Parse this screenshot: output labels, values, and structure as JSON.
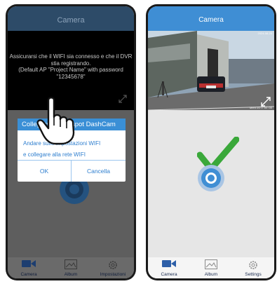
{
  "left_phone": {
    "header": {
      "title": "Camera"
    },
    "video_message": {
      "lines": [
        "Assicurarsi che il WIFI sia connesso e che il DVR",
        "stia registrando.",
        "(Default AP \"Project Name\" with password",
        "\"12345678\""
      ]
    },
    "dialog": {
      "title": "Collegarsi all'Hotspot DashCam",
      "message_lines": [
        "Andare sulle impostazioni WIFI",
        "e collegare alla rete WIFI"
      ],
      "ok_label": "OK",
      "cancel_label": "Cancella"
    },
    "tabs": [
      {
        "label": "Camera",
        "icon": "video-camera-icon"
      },
      {
        "label": "Album",
        "icon": "image-icon"
      },
      {
        "label": "Impostazioni",
        "icon": "gear-icon"
      }
    ]
  },
  "right_phone": {
    "header": {
      "title": "Camera"
    },
    "video": {
      "osd_bottom": "Mem:1G  0 :00 :00",
      "osd_top": "2024-08-20"
    },
    "tabs": [
      {
        "label": "Camera",
        "icon": "video-camera-icon"
      },
      {
        "label": "Album",
        "icon": "image-icon"
      },
      {
        "label": "Settings",
        "icon": "gear-icon"
      }
    ]
  },
  "colors": {
    "header_blue": "#3f8ed4",
    "dialog_blue": "#3a8fd6",
    "check_green": "#3aa83a",
    "tab_active": "#2d5fa8"
  }
}
